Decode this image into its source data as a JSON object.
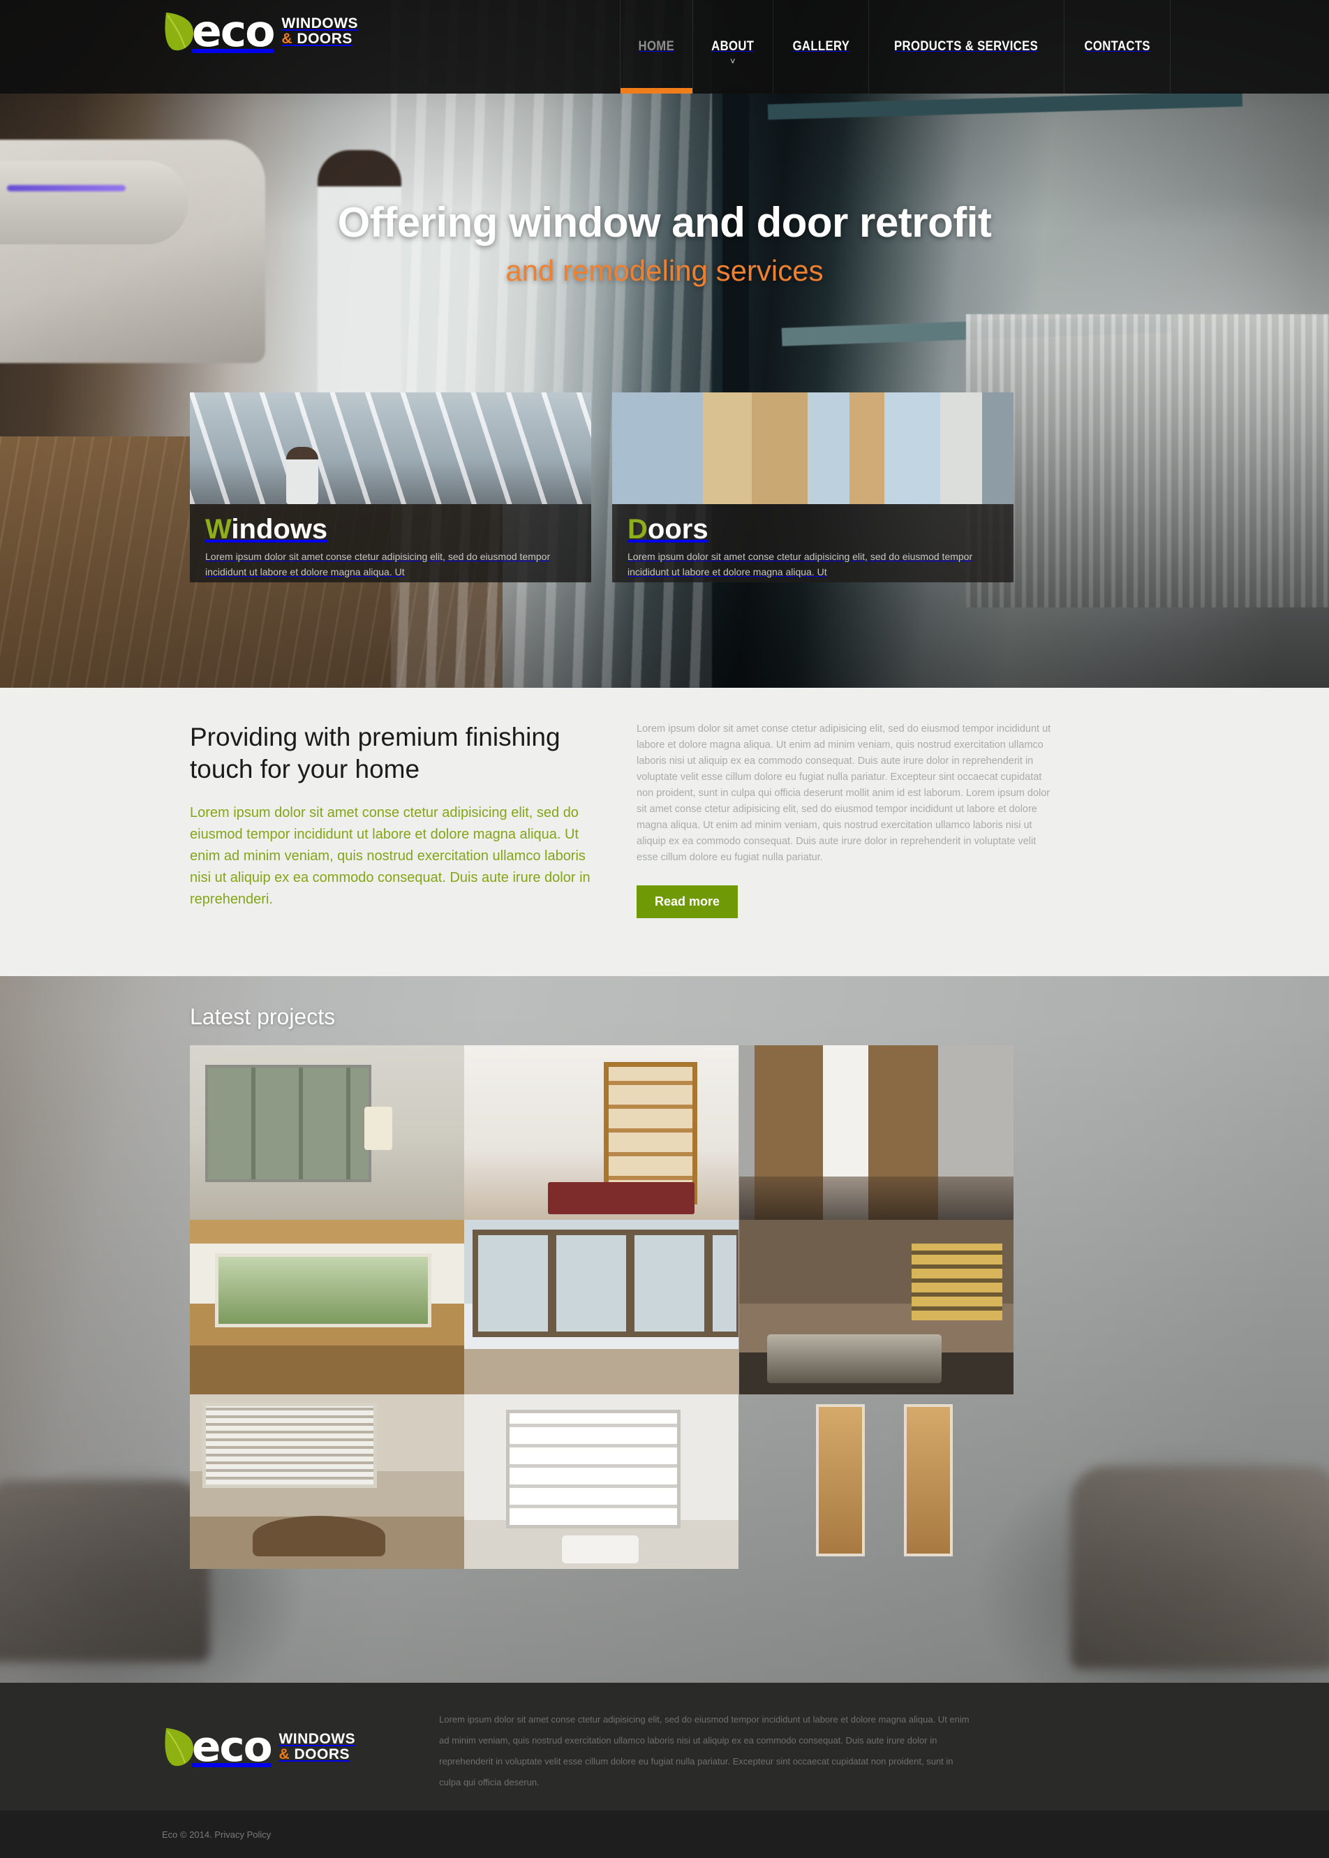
{
  "brand": {
    "name": "eco",
    "line1": "WINDOWS",
    "amp": "&",
    "line2": "DOORS",
    "leaf_icon": "leaf-icon",
    "accent_orange": "#f07d1a",
    "accent_green": "#8fae1c"
  },
  "nav": {
    "items": [
      {
        "label": "HOME",
        "active": true,
        "has_dropdown": false
      },
      {
        "label": "ABOUT",
        "active": false,
        "has_dropdown": true
      },
      {
        "label": "GALLERY",
        "active": false,
        "has_dropdown": false
      },
      {
        "label": "PRODUCTS & SERVICES",
        "active": false,
        "has_dropdown": false
      },
      {
        "label": "CONTACTS",
        "active": false,
        "has_dropdown": false
      }
    ],
    "caret_glyph": "˅"
  },
  "hero": {
    "title": "Offering window and door retrofit",
    "subtitle": "and remodeling services"
  },
  "promos": [
    {
      "title_cap": "W",
      "title_rest": "indows",
      "text": "Lorem ipsum dolor sit amet conse ctetur adipisicing elit, sed do eiusmod tempor incididunt ut labore et dolore magna aliqua. Ut"
    },
    {
      "title_cap": "D",
      "title_rest": "oors",
      "text": "Lorem ipsum dolor sit amet conse ctetur adipisicing elit, sed do eiusmod tempor incididunt ut labore et dolore magna aliqua. Ut"
    }
  ],
  "about": {
    "heading": "Providing with premium finishing touch for your home",
    "green_text": "Lorem ipsum dolor sit amet conse ctetur adipisicing elit, sed do eiusmod tempor incididunt ut labore et dolore magna aliqua. Ut enim ad minim veniam, quis nostrud exercitation ullamco laboris nisi ut aliquip ex ea commodo consequat. Duis aute irure dolor in reprehenderi.",
    "body_text": "Lorem ipsum dolor sit amet conse ctetur adipisicing elit, sed do eiusmod tempor incididunt ut labore et dolore magna aliqua. Ut enim ad minim veniam, quis nostrud exercitation ullamco laboris nisi ut aliquip ex ea commodo consequat. Duis aute irure dolor in reprehenderit in voluptate velit esse cillum dolore eu fugiat nulla pariatur. Excepteur sint occaecat cupidatat non proident, sunt in culpa qui officia deserunt mollit anim id est laborum. Lorem ipsum dolor sit amet conse ctetur adipisicing elit, sed do eiusmod tempor incididunt ut labore et dolore magna aliqua. Ut enim ad minim veniam, quis nostrud exercitation ullamco laboris nisi ut aliquip ex ea commodo consequat. Duis aute irure dolor in reprehenderit in voluptate velit esse cillum dolore eu fugiat nulla pariatur.",
    "button_label": "Read more",
    "button_color": "#6f9a06"
  },
  "projects": {
    "heading": "Latest projects",
    "thumbs": [
      {
        "alt": "living-room-with-windows"
      },
      {
        "alt": "sliding-glass-door-living-room"
      },
      {
        "alt": "wooden-interior-doors"
      },
      {
        "alt": "dining-room-window-view"
      },
      {
        "alt": "panoramic-snow-window"
      },
      {
        "alt": "bedroom-with-shutters"
      },
      {
        "alt": "dining-set-with-blinds"
      },
      {
        "alt": "bathroom-frosted-door"
      },
      {
        "alt": "bedroom-wooden-doors"
      }
    ]
  },
  "footer": {
    "text": "Lorem ipsum dolor sit amet conse ctetur adipisicing elit, sed do eiusmod tempor incididunt ut labore et dolore magna aliqua. Ut enim ad minim veniam, quis nostrud exercitation ullamco laboris nisi ut aliquip ex ea commodo consequat. Duis aute irure dolor in reprehenderit in voluptate velit esse cillum dolore eu fugiat nulla pariatur. Excepteur sint occaecat cupidatat non proident, sunt in culpa qui officia deserun.",
    "copyright": "Eco © 2014. Privacy Policy"
  }
}
